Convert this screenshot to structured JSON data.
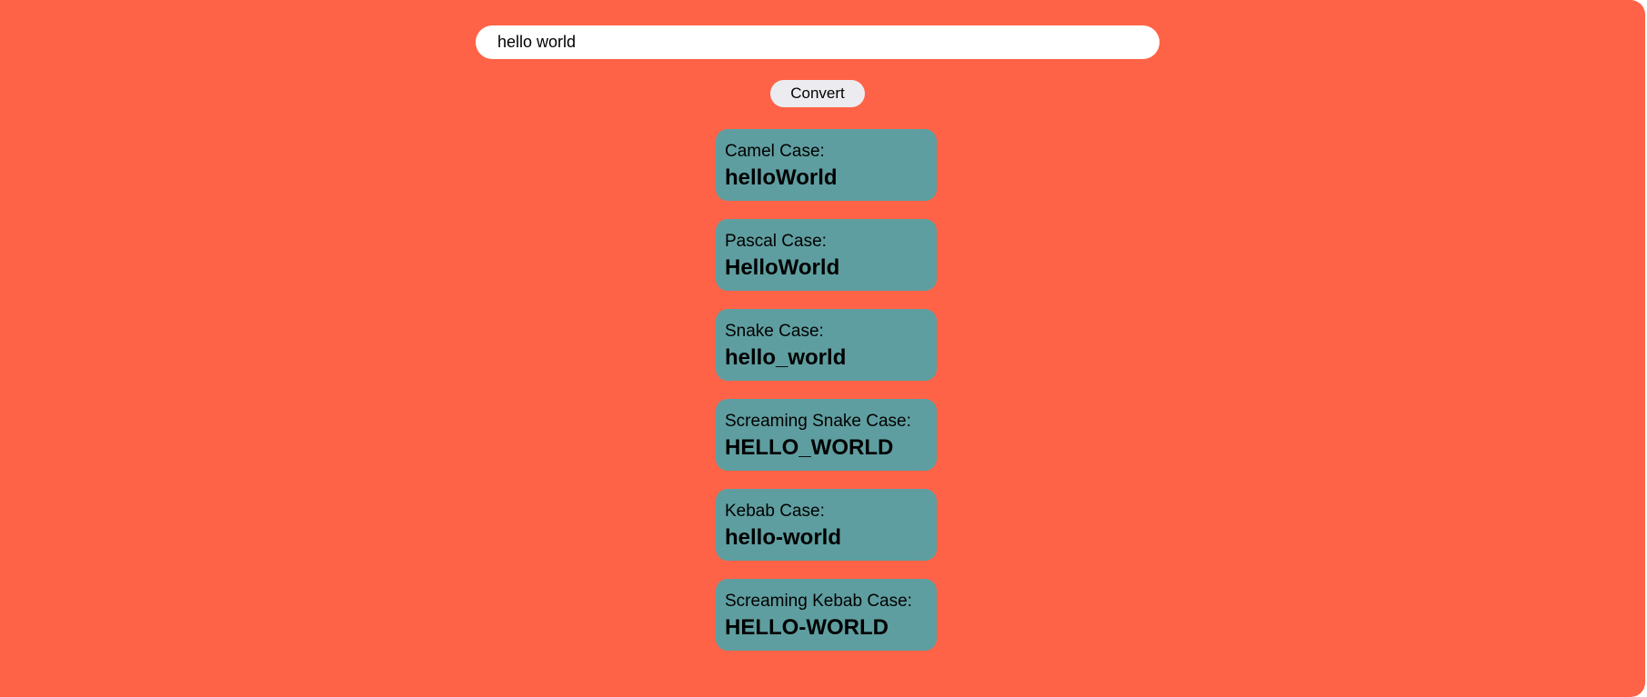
{
  "input": {
    "value": "hello world"
  },
  "convert_button": {
    "label": "Convert"
  },
  "results": [
    {
      "label": "Camel Case:",
      "value": "helloWorld"
    },
    {
      "label": "Pascal Case:",
      "value": "HelloWorld"
    },
    {
      "label": "Snake Case:",
      "value": "hello_world"
    },
    {
      "label": "Screaming Snake Case:",
      "value": "HELLO_WORLD"
    },
    {
      "label": "Kebab Case:",
      "value": "hello-world"
    },
    {
      "label": "Screaming Kebab Case:",
      "value": "HELLO-WORLD"
    }
  ],
  "colors": {
    "background": "#ff6347",
    "card": "#5f9ea0",
    "button": "#ececf0"
  }
}
